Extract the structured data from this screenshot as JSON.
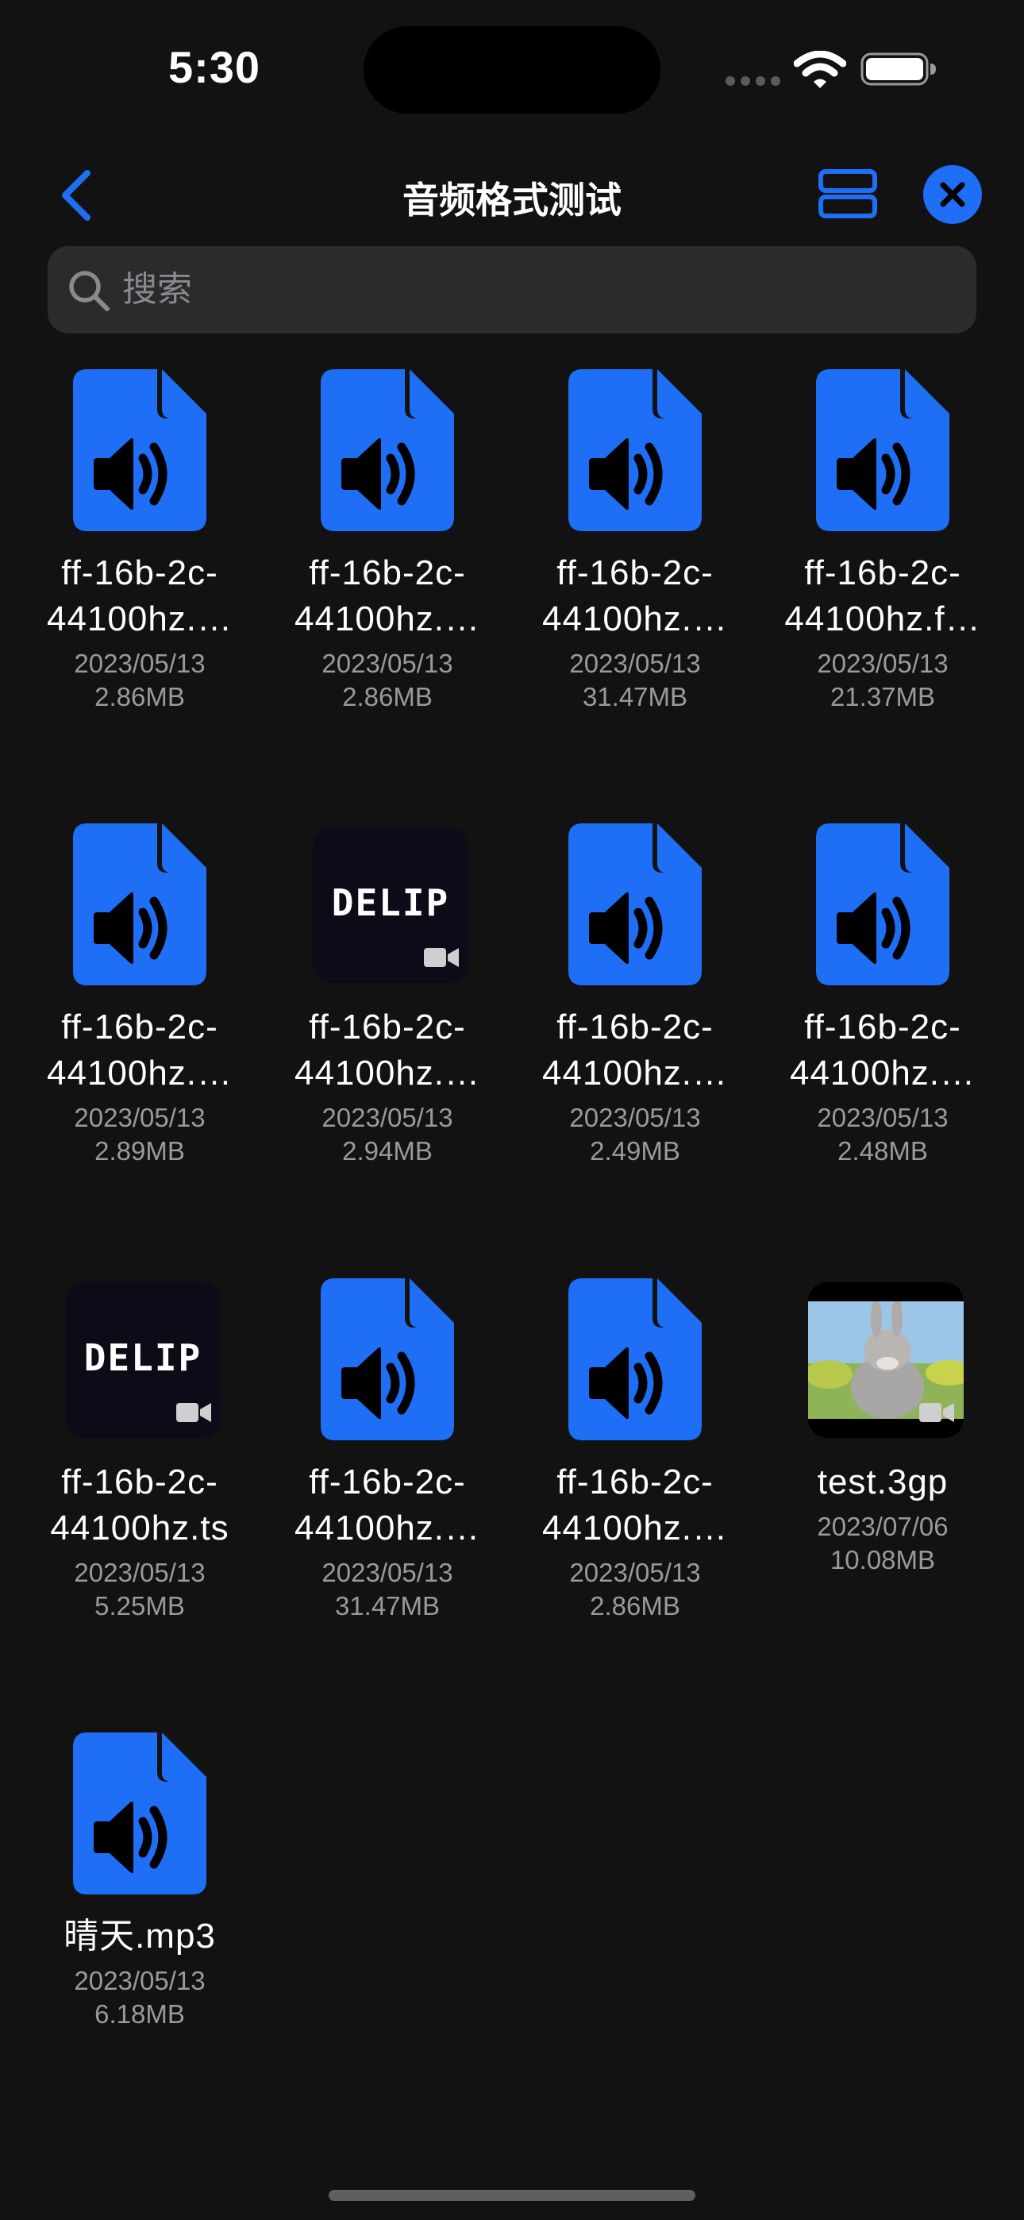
{
  "status_bar": {
    "time": "5:30"
  },
  "nav": {
    "title": "音频格式测试"
  },
  "search": {
    "placeholder": "搜索",
    "value": ""
  },
  "files": [
    {
      "name_line1": "ff-16b-2c-",
      "name_line2": "44100hz.…",
      "date": "2023/05/13",
      "size": "2.86MB",
      "kind": "audio"
    },
    {
      "name_line1": "ff-16b-2c-",
      "name_line2": "44100hz.…",
      "date": "2023/05/13",
      "size": "2.86MB",
      "kind": "audio"
    },
    {
      "name_line1": "ff-16b-2c-",
      "name_line2": "44100hz.…",
      "date": "2023/05/13",
      "size": "31.47MB",
      "kind": "audio"
    },
    {
      "name_line1": "ff-16b-2c-",
      "name_line2": "44100hz.f…",
      "date": "2023/05/13",
      "size": "21.37MB",
      "kind": "audio"
    },
    {
      "name_line1": "ff-16b-2c-",
      "name_line2": "44100hz.…",
      "date": "2023/05/13",
      "size": "2.89MB",
      "kind": "audio"
    },
    {
      "name_line1": "ff-16b-2c-",
      "name_line2": "44100hz.…",
      "date": "2023/05/13",
      "size": "2.94MB",
      "kind": "video",
      "thumb_text": "DELIP"
    },
    {
      "name_line1": "ff-16b-2c-",
      "name_line2": "44100hz.…",
      "date": "2023/05/13",
      "size": "2.49MB",
      "kind": "audio"
    },
    {
      "name_line1": "ff-16b-2c-",
      "name_line2": "44100hz.…",
      "date": "2023/05/13",
      "size": "2.48MB",
      "kind": "audio"
    },
    {
      "name_line1": "ff-16b-2c-",
      "name_line2": "44100hz.ts",
      "date": "2023/05/13",
      "size": "5.25MB",
      "kind": "video",
      "thumb_text": "DELIP"
    },
    {
      "name_line1": "ff-16b-2c-",
      "name_line2": "44100hz.…",
      "date": "2023/05/13",
      "size": "31.47MB",
      "kind": "audio"
    },
    {
      "name_line1": "ff-16b-2c-",
      "name_line2": "44100hz.…",
      "date": "2023/05/13",
      "size": "2.86MB",
      "kind": "audio"
    },
    {
      "name_line1": "test.3gp",
      "name_line2": "",
      "date": "2023/07/06",
      "size": "10.08MB",
      "kind": "video-photo"
    },
    {
      "name_line1": "晴天.mp3",
      "name_line2": "",
      "date": "2023/05/13",
      "size": "6.18MB",
      "kind": "audio"
    }
  ],
  "colors": {
    "accent": "#1e6ff5",
    "background": "#121212",
    "search_bg": "#2b2b2d",
    "secondary_text": "#9a9a9e"
  },
  "icons": {
    "back": "chevron-left-icon",
    "layout": "list-layout-icon",
    "close": "close-icon",
    "search": "search-icon",
    "audio_file": "audio-file-icon",
    "video": "video-camera-icon"
  }
}
